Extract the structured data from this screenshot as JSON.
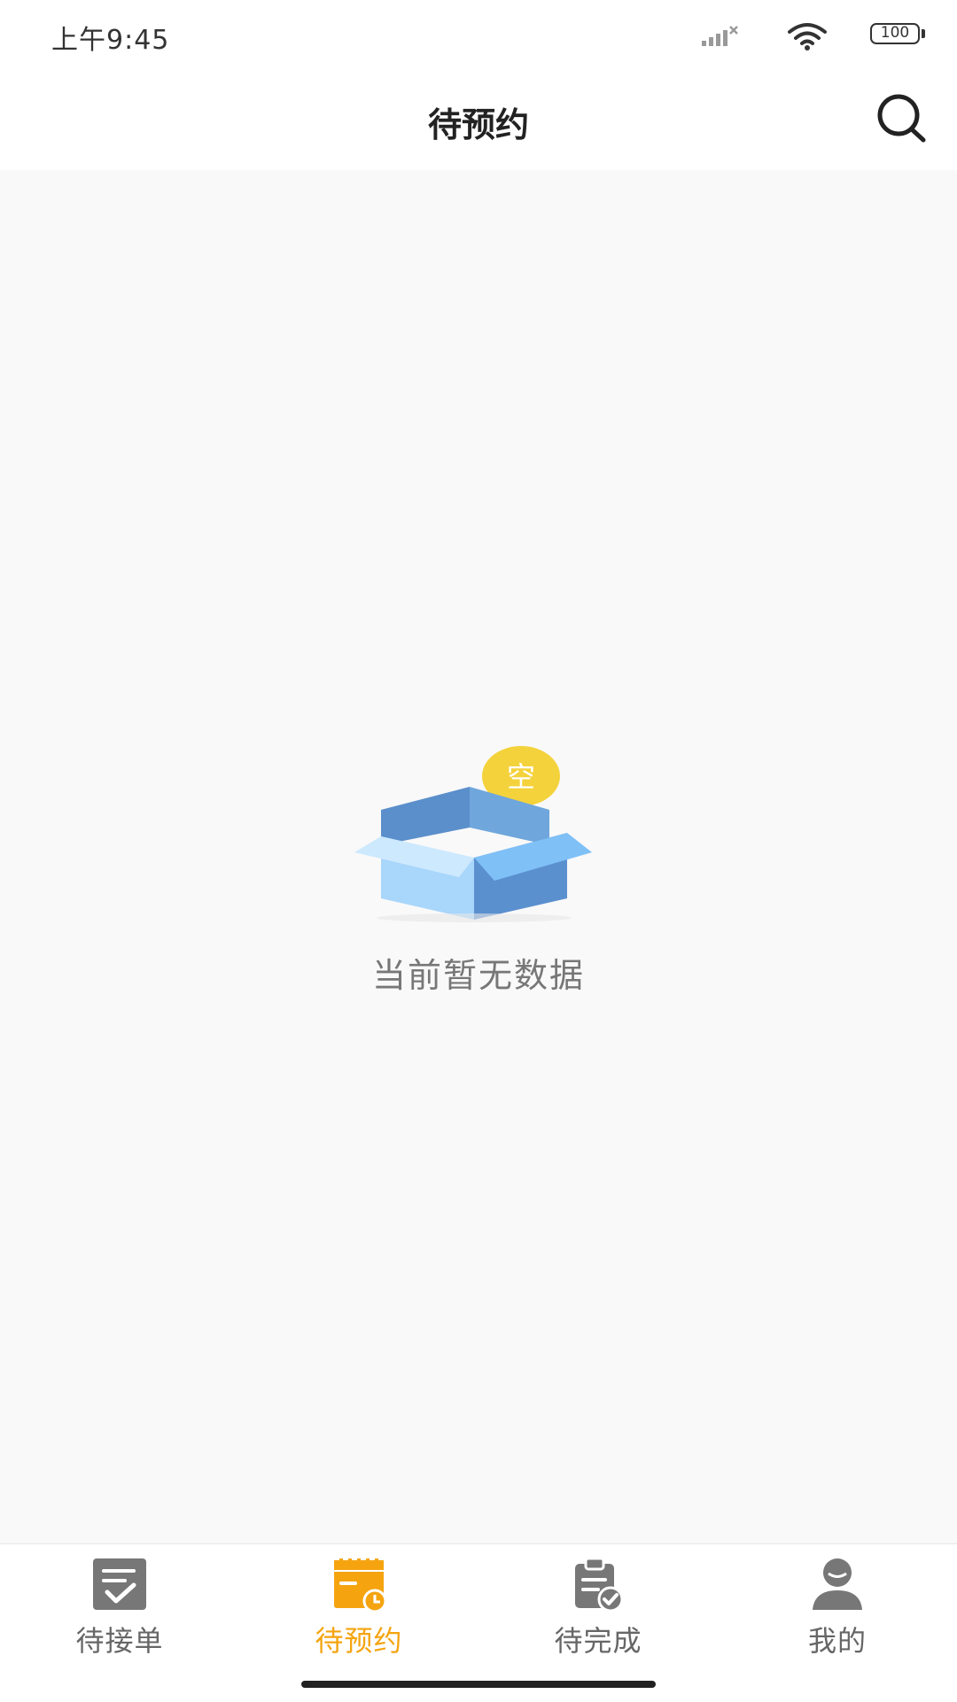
{
  "status_bar": {
    "time": "上午9:45",
    "battery": "100",
    "icons": [
      "signal-icon",
      "wifi-icon",
      "battery-icon"
    ]
  },
  "header": {
    "title": "待预约",
    "search_icon": "search-icon"
  },
  "empty_state": {
    "badge": "空",
    "message": "当前暂无数据"
  },
  "tabbar": {
    "tabs": [
      {
        "label": "待接单",
        "icon": "checklist-icon",
        "active": false
      },
      {
        "label": "待预约",
        "icon": "calendar-clock-icon",
        "active": true
      },
      {
        "label": "待完成",
        "icon": "clipboard-check-icon",
        "active": false
      },
      {
        "label": "我的",
        "icon": "user-icon",
        "active": false
      }
    ]
  },
  "colors": {
    "accent": "#f5a410",
    "inactive": "#666666",
    "background": "#f9f9f9"
  }
}
